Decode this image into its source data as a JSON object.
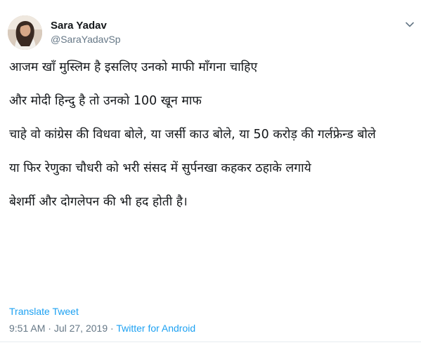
{
  "user": {
    "display_name": "Sara Yadav",
    "handle": "@SaraYadavSp",
    "avatar_icon": "profile-photo"
  },
  "menu_icon": "chevron-down-icon",
  "tweet": {
    "paragraphs": [
      "आजम खाँ मुस्लिम है इसलिए उनको माफी माँगना चाहिए",
      "और मोदी हिन्दु है तो उनको 100 खून माफ",
      "चाहे वो कांग्रेस की विधवा बोले, या जर्सी काउ बोले, या 50 करोड़ की गर्लफ्रेन्ड बोले",
      "या फिर रेणुका चौधरी को भरी संसद में सुर्पनखा कहकर ठहाके लगाये",
      "बेशर्मी और दोगलेपन की भी हद होती है।"
    ],
    "translate_label": "Translate Tweet",
    "time": "9:51 AM",
    "separator": " · ",
    "date": "Jul 27, 2019",
    "source": "Twitter for Android"
  },
  "colors": {
    "link": "#1da1f2",
    "secondary_text": "#657786",
    "primary_text": "#14171a",
    "divider": "#e6ecf0"
  }
}
